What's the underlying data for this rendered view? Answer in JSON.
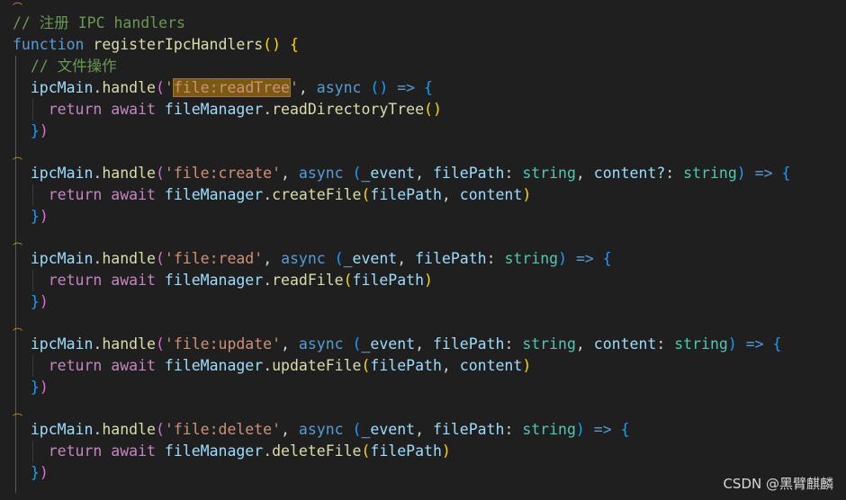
{
  "editor": {
    "watermark": "CSDN @黑臂麒麟"
  },
  "code": {
    "comment_header": "// 注册 IPC handlers",
    "fn_kw": "function",
    "fn_name": "registerIpcHandlers",
    "comment_file_ops": "// 文件操作",
    "ipc_obj": "ipcMain",
    "handle": "handle",
    "async": "async",
    "return": "return",
    "await": "await",
    "fm": "fileManager",
    "ch_readTree": "'file:readTree'",
    "ch_create": "'file:create'",
    "ch_read": "'file:read'",
    "ch_update": "'file:update'",
    "ch_delete": "'file:delete'",
    "m_readTree": "readDirectoryTree",
    "m_create": "createFile",
    "m_read": "readFile",
    "m_update": "updateFile",
    "m_delete": "deleteFile",
    "p_event": "_event",
    "p_filePath": "filePath",
    "p_content": "content",
    "p_contentOpt": "content?",
    "t_string": "string",
    "arrow": "=>"
  }
}
